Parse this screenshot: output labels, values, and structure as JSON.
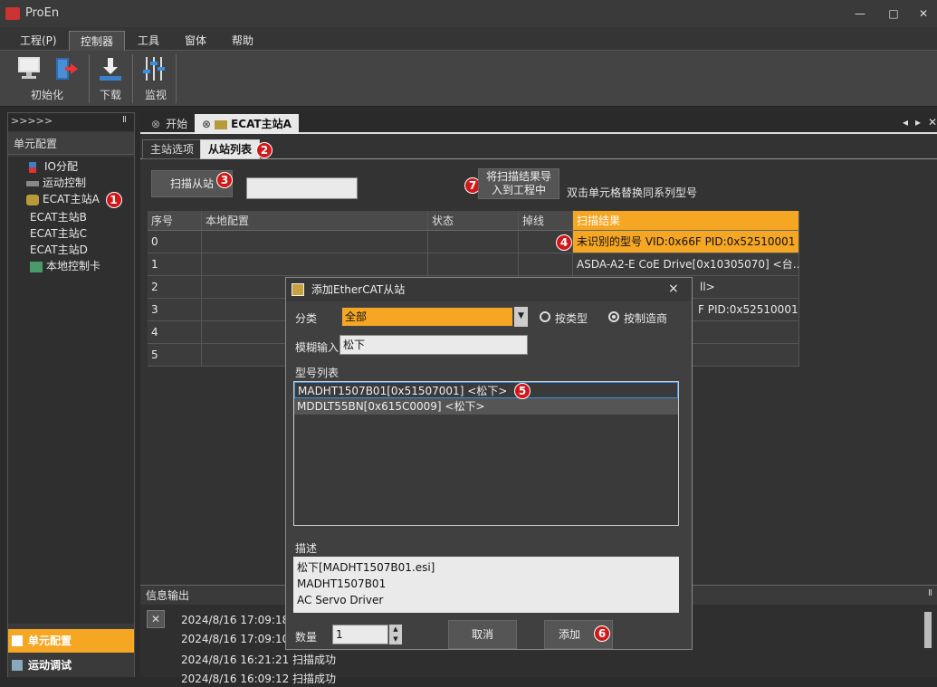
{
  "app": {
    "title": "ProEn",
    "win_min": "—",
    "win_max": "□",
    "win_close": "✕"
  },
  "menu": [
    "工程(P)",
    "控制器",
    "工具",
    "窗体",
    "帮助"
  ],
  "ribbon": {
    "init_label": "初始化",
    "download_label": "下载",
    "monitor_label": "监视"
  },
  "left_panel": {
    "header": ">>>>>",
    "pin": "Ⅱ",
    "section": "单元配置",
    "tree": [
      "IO分配",
      "运动控制",
      "ECAT主站A",
      "ECAT主站B",
      "ECAT主站C",
      "ECAT主站D",
      "本地控制卡"
    ],
    "bottom_buttons": [
      "单元配置",
      "运动调试"
    ]
  },
  "doc": {
    "tabs": [
      "开始",
      "ECAT主站A"
    ],
    "subtabs": [
      "主站选项",
      "从站列表"
    ],
    "scan_button": "扫描从站",
    "import_button_l1": "将扫描结果导",
    "import_button_l2": "入到工程中",
    "hint": "双击单元格替换同系列型号",
    "grid_headers": [
      "序号",
      "本地配置",
      "状态",
      "掉线",
      "扫描结果"
    ],
    "rows": [
      {
        "idx": "0",
        "scan": "未识别的型号 VID:0x66F PID:0x52510001"
      },
      {
        "idx": "1",
        "scan": "ASDA-A2-E CoE Drive[0x10305070] <台…"
      },
      {
        "idx": "2",
        "scan": "ll>"
      },
      {
        "idx": "3",
        "scan": "F PID:0x52510001"
      },
      {
        "idx": "4",
        "scan": ""
      },
      {
        "idx": "5",
        "scan": ""
      }
    ]
  },
  "dialog": {
    "title": "添加EtherCAT从站",
    "close": "×",
    "category_label": "分类",
    "category_value": "全部",
    "radio_type": "按类型",
    "radio_vendor": "按制造商",
    "fuzzy_label": "模糊输入",
    "fuzzy_value": "松下",
    "models_label": "型号列表",
    "models": [
      "MADHT1507B01[0x51507001] <松下>",
      "MDDLT55BN[0x615C0009] <松下>"
    ],
    "desc_label": "描述",
    "desc_lines": [
      "松下[MADHT1507B01.esi]",
      "MADHT1507B01",
      "AC Servo Driver"
    ],
    "qty_label": "数量",
    "qty_value": "1",
    "cancel": "取消",
    "add": "添加"
  },
  "info": {
    "title": "信息输出",
    "pin": "Ⅱ",
    "logs": [
      "2024/8/16 17:09:18",
      "2024/8/16 17:09:10",
      "2024/8/16 16:21:21 扫描成功",
      "2024/8/16 16:09:12 扫描成功"
    ]
  },
  "badges": [
    "1",
    "2",
    "3",
    "4",
    "5",
    "6",
    "7"
  ],
  "colors": {
    "accent_orange": "#f5a623",
    "badge_red": "#d01818",
    "bg_dark": "#2b2b2b"
  }
}
